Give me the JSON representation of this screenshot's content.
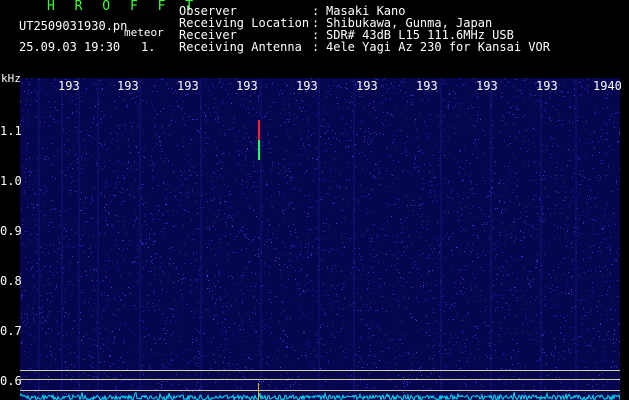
{
  "header": {
    "program": "H R O F F T",
    "file": "UT2509031930.pn",
    "tag": "meteor",
    "datetime": "25.09.03 19:30",
    "interval": "1.",
    "fields": [
      {
        "label": "Observer",
        "value": "Masaki Kano"
      },
      {
        "label": "Receiving Location",
        "value": "Shibukawa, Gunma, Japan"
      },
      {
        "label": "Receiver",
        "value": "SDR# 43dB L15 111.6MHz USB"
      },
      {
        "label": "Receiving Antenna",
        "value": "4ele Yagi Az 230 for Kansai VOR"
      }
    ]
  },
  "axes": {
    "y_unit": "kHz",
    "y_ticks": [
      "1.1",
      "1.0",
      "0.9",
      "0.8",
      "0.7",
      "0.6"
    ],
    "x_ticks": [
      "193",
      "193",
      "193",
      "193",
      "193",
      "193",
      "193",
      "193",
      "193",
      "1940"
    ]
  },
  "colors": {
    "background": "#06064e",
    "text": "#ffffff",
    "title": "#3cff3c",
    "noise": "#00e0ff",
    "echo_red": "#ff2020",
    "echo_green": "#20ff60",
    "marker": "#e0c000"
  },
  "echo": {
    "time_frac": 0.397,
    "freq_top": 1.12,
    "freq_bottom": 1.04
  }
}
